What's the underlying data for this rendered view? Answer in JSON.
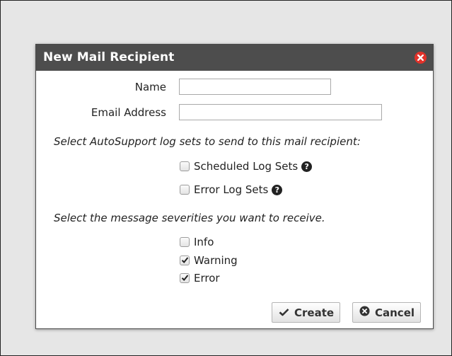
{
  "dialog": {
    "title": "New Mail Recipient",
    "close_icon": "close-circle-icon",
    "name_label": "Name",
    "name_value": "",
    "email_label": "Email Address",
    "email_value": "",
    "log_sets_prompt": "Select AutoSupport log sets to send to this mail recipient:",
    "log_sets": [
      {
        "label": "Scheduled Log Sets",
        "checked": false,
        "help_icon": "question-circle-icon"
      },
      {
        "label": "Error Log Sets",
        "checked": false,
        "help_icon": "question-circle-icon"
      }
    ],
    "severities_prompt": "Select the message severities you want to receive.",
    "severities": [
      {
        "label": "Info",
        "checked": false
      },
      {
        "label": "Warning",
        "checked": true
      },
      {
        "label": "Error",
        "checked": true
      }
    ],
    "buttons": {
      "create_label": "Create",
      "create_icon": "check-icon",
      "cancel_label": "Cancel",
      "cancel_icon": "times-circle-icon"
    }
  },
  "colors": {
    "titlebar": "#4d4d4d",
    "close_icon": "#e2322a",
    "backdrop": "#e6e6e6"
  }
}
